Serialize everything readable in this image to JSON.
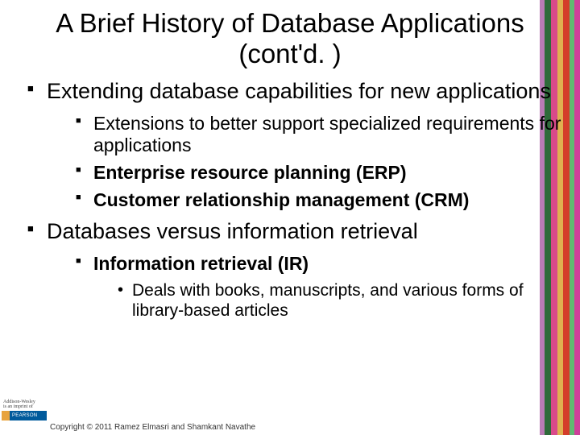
{
  "title": "A Brief History of Database Applications (cont'd. )",
  "bullets": {
    "b1": {
      "text": "Extending database capabilities for new applications",
      "sub": {
        "s1": "Extensions to better support specialized requirements for applications",
        "s2": "Enterprise resource planning (ERP)",
        "s3": "Customer relationship management (CRM)"
      }
    },
    "b2": {
      "text": "Databases versus information retrieval",
      "sub": {
        "s1": "Information retrieval (IR)",
        "s1_sub": {
          "d1": "Deals with books, manuscripts, and various forms of library-based articles"
        }
      }
    }
  },
  "footer": {
    "imprint1": "Addison-Wesley",
    "imprint2": "is an imprint of",
    "brand": "PEARSON",
    "copyright": "Copyright © 2011 Ramez Elmasri and Shamkant Navathe"
  },
  "stripes": [
    "#b97bb5",
    "#2e6b3a",
    "#d94a8a",
    "#e0b050",
    "#d43d2a",
    "#5fb971",
    "#ce3f9a"
  ]
}
